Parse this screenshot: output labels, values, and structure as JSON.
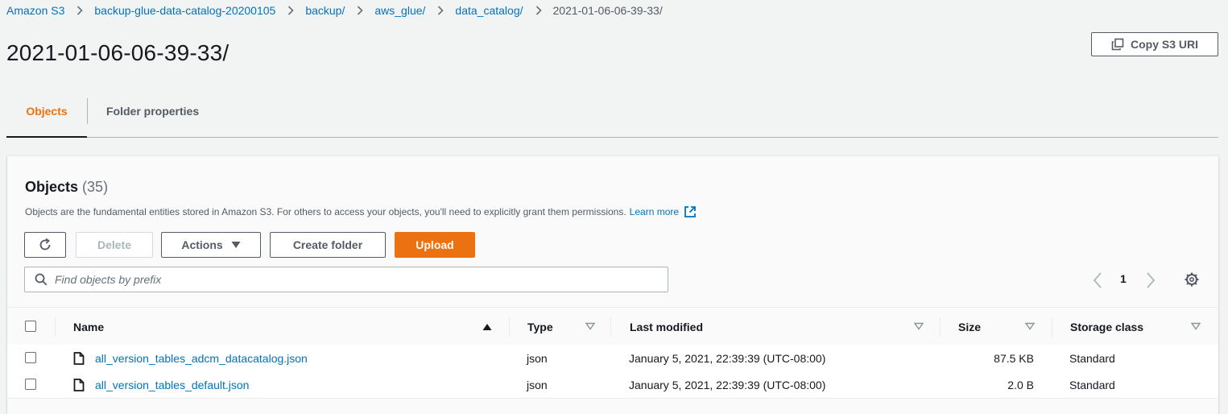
{
  "breadcrumb": {
    "items": [
      "Amazon S3",
      "backup-glue-data-catalog-20200105",
      "backup/",
      "aws_glue/",
      "data_catalog/"
    ],
    "current": "2021-01-06-06-39-33/"
  },
  "page": {
    "title": "2021-01-06-06-39-33/",
    "copy_uri_label": "Copy S3 URI"
  },
  "tabs": [
    {
      "label": "Objects",
      "active": true
    },
    {
      "label": "Folder properties",
      "active": false
    }
  ],
  "objects_panel": {
    "heading": "Objects",
    "count": "(35)",
    "description": "Objects are the fundamental entities stored in Amazon S3. For others to access your objects, you'll need to explicitly grant them permissions.",
    "learn_more": "Learn more",
    "buttons": {
      "delete": "Delete",
      "actions": "Actions",
      "create_folder": "Create folder",
      "upload": "Upload"
    },
    "search_placeholder": "Find objects by prefix",
    "page_number": "1",
    "columns": [
      "Name",
      "Type",
      "Last modified",
      "Size",
      "Storage class"
    ],
    "rows": [
      {
        "name": "all_version_tables_adcm_datacatalog.json",
        "type": "json",
        "last_modified": "January 5, 2021, 22:39:39 (UTC-08:00)",
        "size": "87.5 KB",
        "storage_class": "Standard"
      },
      {
        "name": "all_version_tables_default.json",
        "type": "json",
        "last_modified": "January 5, 2021, 22:39:39 (UTC-08:00)",
        "size": "2.0 B",
        "storage_class": "Standard"
      }
    ]
  },
  "colors": {
    "link": "#0073bb",
    "accent": "#ec7211",
    "background": "#f2f3f3"
  },
  "icons": [
    "chevron-right-icon",
    "copy-icon",
    "external-link-icon",
    "refresh-icon",
    "caret-down-icon",
    "search-icon",
    "chevron-left-icon",
    "gear-icon",
    "sort-ascending-icon",
    "sort-descending-icon",
    "file-icon"
  ]
}
